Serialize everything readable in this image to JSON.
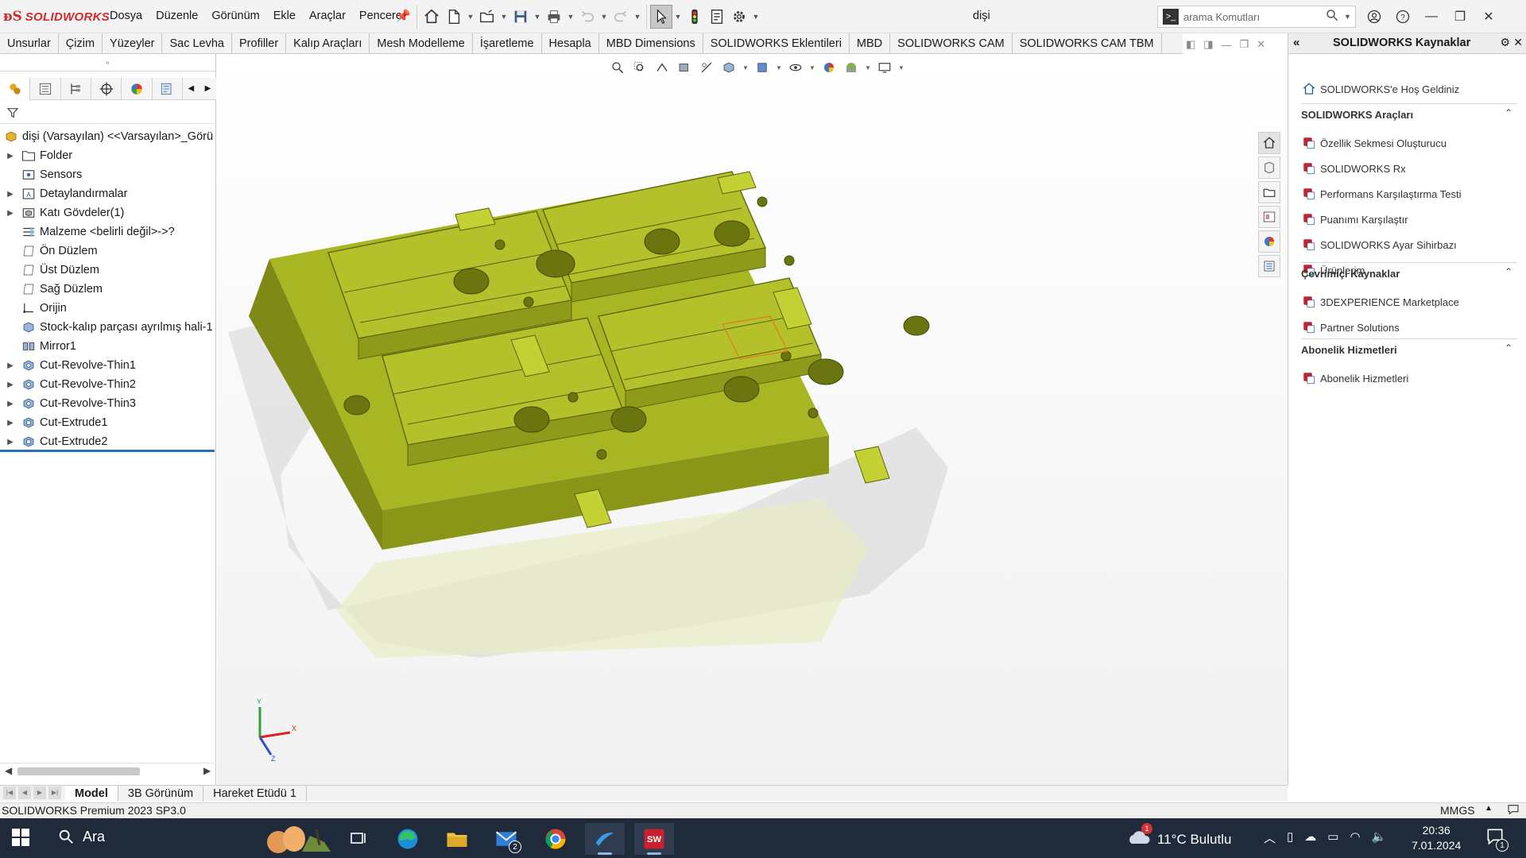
{
  "app": {
    "brand": "SOLIDWORKS",
    "document_title": "dişi"
  },
  "menus": [
    "Dosya",
    "Düzenle",
    "Görünüm",
    "Ekle",
    "Araçlar",
    "Pencere"
  ],
  "search": {
    "placeholder": "arama Komutları"
  },
  "command_tabs": [
    "Unsurlar",
    "Çizim",
    "Yüzeyler",
    "Sac Levha",
    "Profiller",
    "Kalıp Araçları",
    "Mesh Modelleme",
    "İşaretleme",
    "Hesapla",
    "MBD Dimensions",
    "SOLIDWORKS Eklentileri",
    "MBD",
    "SOLIDWORKS CAM",
    "SOLIDWORKS CAM TBM"
  ],
  "feature_tree": {
    "root": "dişi (Varsayılan) <<Varsayılan>_Görü",
    "items": [
      {
        "label": "Folder",
        "expandable": true,
        "icon": "folder-icon"
      },
      {
        "label": "Sensors",
        "expandable": false,
        "icon": "sensor-icon"
      },
      {
        "label": "Detaylandırmalar",
        "expandable": true,
        "icon": "annotation-icon"
      },
      {
        "label": "Katı Gövdeler(1)",
        "expandable": true,
        "icon": "solid-bodies-icon"
      },
      {
        "label": "Malzeme <belirli değil>->?",
        "expandable": false,
        "icon": "material-icon"
      },
      {
        "label": "Ön Düzlem",
        "expandable": false,
        "icon": "plane-icon"
      },
      {
        "label": "Üst Düzlem",
        "expandable": false,
        "icon": "plane-icon"
      },
      {
        "label": "Sağ Düzlem",
        "expandable": false,
        "icon": "plane-icon"
      },
      {
        "label": "Orijin",
        "expandable": false,
        "icon": "origin-icon"
      },
      {
        "label": "Stock-kalıp parçası ayrılmış hali-1",
        "expandable": false,
        "icon": "part-icon"
      },
      {
        "label": "Mirror1",
        "expandable": false,
        "icon": "mirror-icon"
      },
      {
        "label": "Cut-Revolve-Thin1",
        "expandable": true,
        "icon": "cut-revolve-icon"
      },
      {
        "label": "Cut-Revolve-Thin2",
        "expandable": true,
        "icon": "cut-revolve-icon"
      },
      {
        "label": "Cut-Revolve-Thin3",
        "expandable": true,
        "icon": "cut-revolve-icon"
      },
      {
        "label": "Cut-Extrude1",
        "expandable": true,
        "icon": "cut-extrude-icon"
      },
      {
        "label": "Cut-Extrude2",
        "expandable": true,
        "icon": "cut-extrude-icon"
      }
    ]
  },
  "triad": {
    "x": "X",
    "y": "Y",
    "z": "Z"
  },
  "task_pane": {
    "title": "SOLIDWORKS Kaynaklar",
    "welcome": "SOLIDWORKS'e Hoş Geldiniz",
    "sections": [
      {
        "title": "SOLIDWORKS Araçları",
        "items": [
          "Özellik Sekmesi Oluşturucu",
          "SOLIDWORKS Rx",
          "Performans Karşılaştırma Testi",
          "Puanımı Karşılaştır",
          "SOLIDWORKS Ayar Sihirbazı",
          "Ürünlerim"
        ]
      },
      {
        "title": "Çevrimiçi Kaynaklar",
        "items": [
          "3DEXPERIENCE Marketplace",
          "Partner Solutions"
        ]
      },
      {
        "title": "Abonelik Hizmetleri",
        "items": [
          "Abonelik Hizmetleri"
        ]
      }
    ]
  },
  "bottom_tabs": [
    "Model",
    "3B Görünüm",
    "Hareket Etüdü 1"
  ],
  "status": {
    "left": "SOLIDWORKS Premium 2023 SP3.0",
    "units": "MMGS",
    "arrow": "▲"
  },
  "taskbar": {
    "search_label": "Ara",
    "mail_badge": "2",
    "weather": "11°C Bulutlu",
    "weather_badge": "1",
    "time": "20:36",
    "date": "7.01.2024",
    "notif_badge": "1"
  },
  "colors": {
    "model": "#a7b421",
    "model_dark": "#6f7a12",
    "model_light": "#c9d53a",
    "accent": "#d12b2b",
    "taskbar": "#1f2a3a"
  }
}
